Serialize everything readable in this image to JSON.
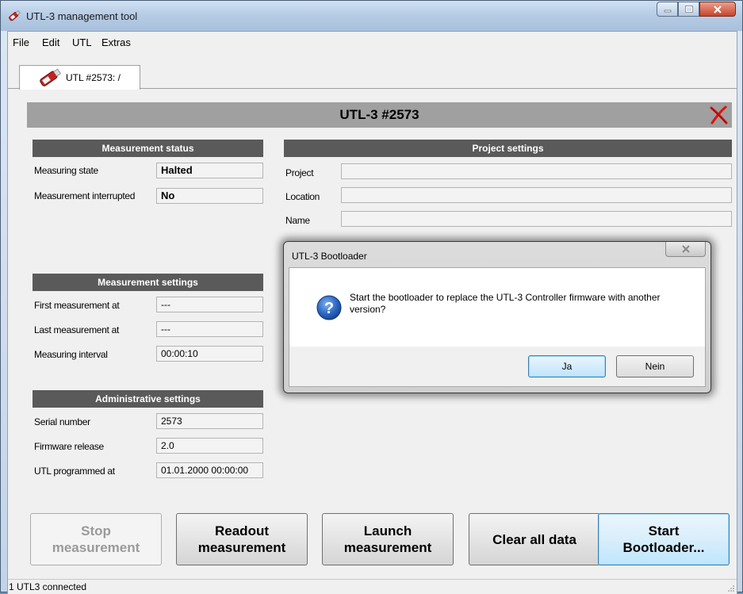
{
  "window": {
    "title": "UTL-3 management tool"
  },
  "menu": [
    "File",
    "Edit",
    "UTL",
    "Extras"
  ],
  "tab": {
    "label": "UTL #2573: /"
  },
  "header": {
    "title": "UTL-3 #2573"
  },
  "measurement_status": {
    "heading": "Measurement status",
    "rows": [
      {
        "label": "Measuring state",
        "value": "Halted"
      },
      {
        "label": "Measurement interrupted",
        "value": "No"
      }
    ]
  },
  "project_settings": {
    "heading": "Project settings",
    "rows": [
      {
        "label": "Project",
        "value": ""
      },
      {
        "label": "Location",
        "value": ""
      },
      {
        "label": "Name",
        "value": ""
      }
    ]
  },
  "measurement_settings": {
    "heading": "Measurement settings",
    "rows": [
      {
        "label": "First measurement at",
        "value": "---"
      },
      {
        "label": "Last measurement at",
        "value": "---"
      },
      {
        "label": "Measuring interval",
        "value": "00:00:10"
      }
    ]
  },
  "administrative_settings": {
    "heading": "Administrative settings",
    "rows": [
      {
        "label": "Serial number",
        "value": "2573"
      },
      {
        "label": "Firmware release",
        "value": "2.0"
      },
      {
        "label": "UTL programmed at",
        "value": "01.01.2000 00:00:00"
      }
    ]
  },
  "buttons": {
    "stop": "Stop\nmeasurement",
    "readout": "Readout\nmeasurement",
    "launch": "Launch\nmeasurement",
    "clear": "Clear all data",
    "bootloader": "Start\nBootloader..."
  },
  "status": {
    "text": "1 UTL3 connected"
  },
  "dialog": {
    "title": "UTL-3 Bootloader",
    "message": "Start the bootloader to replace the UTL-3 Controller firmware with another version?",
    "yes": "Ja",
    "no": "Nein"
  },
  "icons": {
    "app": "usb-logger-icon",
    "close_device": "red-x-icon",
    "question": "question-icon"
  }
}
